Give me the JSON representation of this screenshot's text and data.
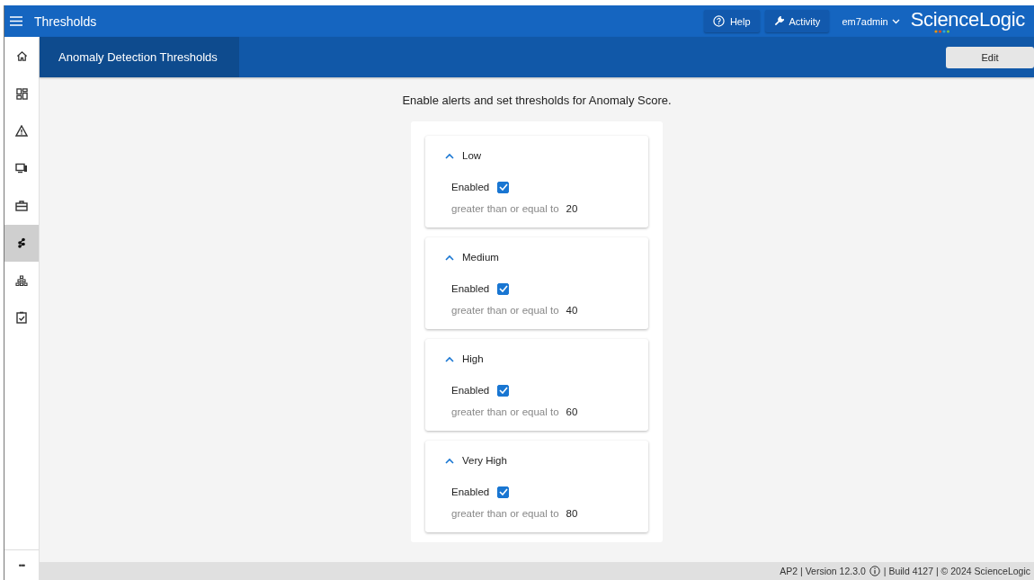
{
  "app_bar": {
    "title": "Thresholds",
    "help": "Help",
    "activity": "Activity",
    "user": "em7admin",
    "logo": "ScienceLogic"
  },
  "sidebar": {
    "items": [
      {
        "selected": false
      },
      {
        "selected": false
      },
      {
        "selected": false
      },
      {
        "selected": false
      },
      {
        "selected": false
      },
      {
        "selected": true
      },
      {
        "selected": false
      },
      {
        "selected": false
      }
    ],
    "more": "•••"
  },
  "page_tab": {
    "label": "Anomaly Detection Thresholds",
    "selected": true
  },
  "edit_button": "Edit",
  "instructions": "Enable alerts and set thresholds for Anomaly Score.",
  "levels": [
    {
      "name": "Low",
      "expanded": true,
      "enabled_label": "Enabled",
      "checked": true,
      "condition": "greater than or equal to",
      "value": "20"
    },
    {
      "name": "Medium",
      "expanded": true,
      "enabled_label": "Enabled",
      "checked": true,
      "condition": "greater than or equal to",
      "value": "40"
    },
    {
      "name": "High",
      "expanded": true,
      "enabled_label": "Enabled",
      "checked": true,
      "condition": "greater than or equal to",
      "value": "60"
    },
    {
      "name": "Very High",
      "expanded": true,
      "enabled_label": "Enabled",
      "checked": true,
      "condition": "greater than or equal to",
      "value": "80"
    }
  ],
  "footer": {
    "version": "AP2 | Version 12.3.0",
    "build": "| Build 4127 | © 2024 ScienceLogic"
  }
}
